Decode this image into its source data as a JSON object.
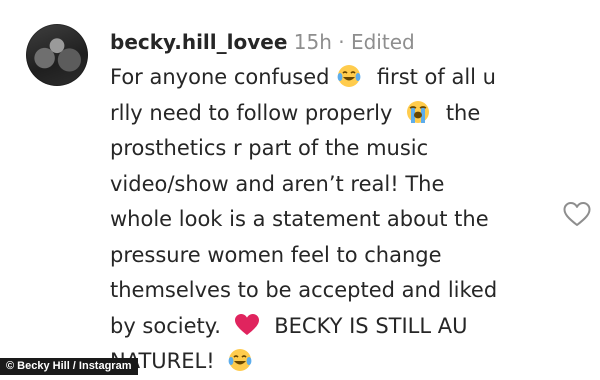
{
  "comment": {
    "username": "becky.hill_lovee",
    "time": "15h",
    "separator": "·",
    "edited": "Edited",
    "lines": [
      [
        "For anyone confused",
        "first of all u"
      ],
      [
        "rlly need to follow properly",
        "the"
      ],
      [
        "prosthetics r part of the music"
      ],
      [
        "video/show and aren’t real! The"
      ],
      [
        "whole look is a statement about the"
      ],
      [
        "pressure women feel to change"
      ],
      [
        "themselves to be accepted and liked"
      ],
      [
        "by society.",
        "BECKY IS STILL AU"
      ],
      [
        "NATUREL!"
      ]
    ],
    "emojis": [
      "face-with-tears-of-joy-icon",
      "loudly-crying-face-icon",
      "red-heart-icon",
      "face-with-tears-of-joy-icon"
    ]
  },
  "photo_credit": "© Becky Hill / Instagram",
  "colors": {
    "text": "#262626",
    "muted": "#8e8e8e",
    "heart": "#e0245e",
    "emoji": "#ffcc4d"
  }
}
